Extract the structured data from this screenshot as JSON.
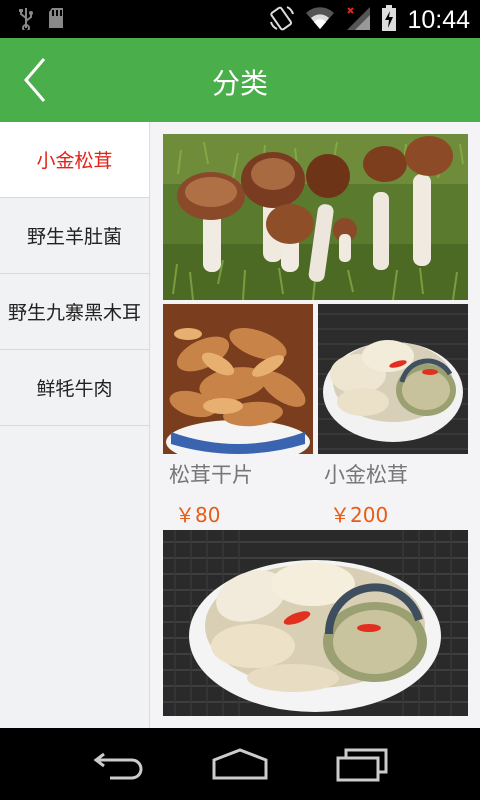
{
  "status_bar": {
    "time": "10:44",
    "icons": [
      "usb-icon",
      "sd-card-icon",
      "rotate-icon",
      "wifi-icon",
      "signal-icon",
      "battery-charging-icon"
    ]
  },
  "header": {
    "title": "分类",
    "back_icon": "chevron-left-icon"
  },
  "sidebar": {
    "items": [
      {
        "label": "小金松茸",
        "active": true
      },
      {
        "label": "野生羊肚菌",
        "active": false
      },
      {
        "label": "野生九寨黑木耳",
        "active": false
      },
      {
        "label": "鲜牦牛肉",
        "active": false
      }
    ]
  },
  "products": [
    {
      "name": "松茸干片",
      "price": "￥80"
    },
    {
      "name": "小金松茸",
      "price": "￥200"
    }
  ],
  "nav": {
    "icons": [
      "back-arrow-icon",
      "home-icon",
      "recent-apps-icon"
    ]
  },
  "colors": {
    "header_green": "#4aae4a",
    "active_red": "#e2231a",
    "price_orange": "#e85c14"
  }
}
